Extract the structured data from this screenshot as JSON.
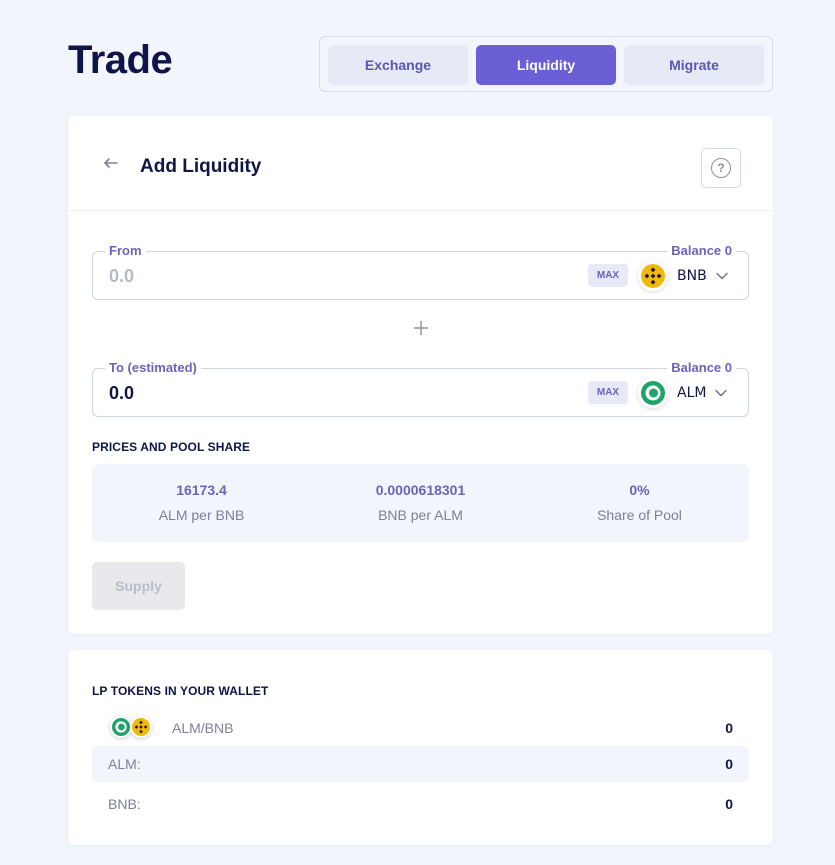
{
  "page": {
    "title": "Trade"
  },
  "tabs": [
    {
      "label": "Exchange",
      "active": false
    },
    {
      "label": "Liquidity",
      "active": true
    },
    {
      "label": "Migrate",
      "active": false
    }
  ],
  "add_liquidity": {
    "title": "Add Liquidity",
    "help_symbol": "?",
    "from": {
      "label": "From",
      "balance": "Balance 0",
      "placeholder": "0.0",
      "max_label": "MAX",
      "token": "BNB",
      "token_icon": "bnb-icon"
    },
    "to": {
      "label": "To (estimated)",
      "balance": "Balance 0",
      "value": "0.0",
      "max_label": "MAX",
      "token": "ALM",
      "token_icon": "alm-icon"
    },
    "prices": {
      "label": "PRICES AND POOL SHARE",
      "items": [
        {
          "value": "16173.4",
          "label": "ALM per BNB"
        },
        {
          "value": "0.0000618301",
          "label": "BNB per ALM"
        },
        {
          "value": "0%",
          "label": "Share of Pool"
        }
      ]
    },
    "supply_label": "Supply"
  },
  "lp_tokens": {
    "label": "LP TOKENS IN YOUR WALLET",
    "pair": {
      "name": "ALM/BNB",
      "value": "0"
    },
    "rows": [
      {
        "label": "ALM:",
        "value": "0"
      },
      {
        "label": "BNB:",
        "value": "0"
      }
    ]
  },
  "colors": {
    "accent": "#6a5fd5",
    "background": "#f2f5fc",
    "bnb_yellow": "#f0b90b",
    "alm_green": "#1fa36a",
    "text_dark": "#0f1546"
  }
}
